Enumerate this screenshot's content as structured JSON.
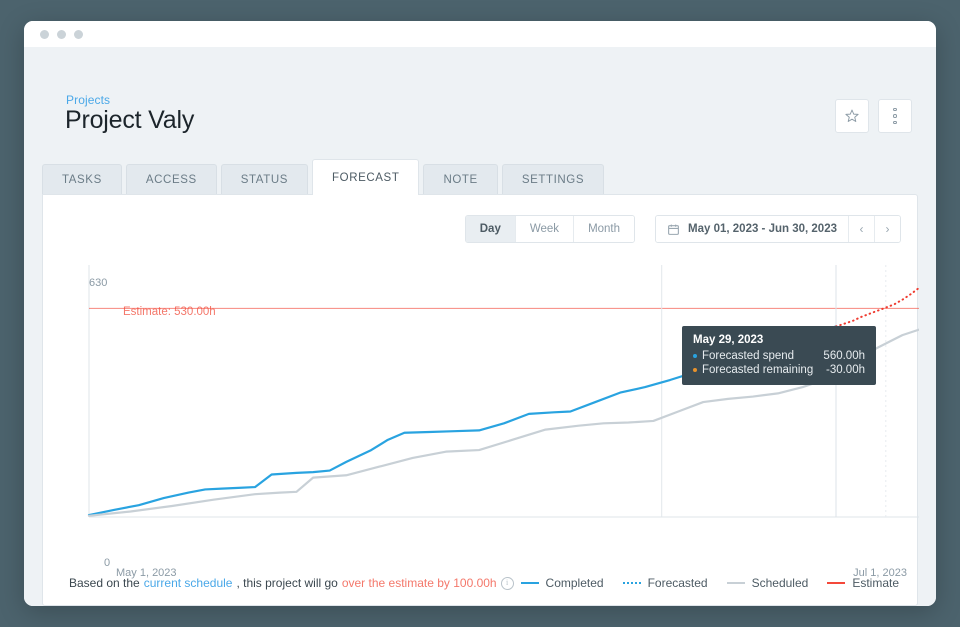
{
  "window": {
    "traffic_dots": 3
  },
  "header": {
    "breadcrumb": "Projects",
    "title": "Project Valy",
    "favorite_icon": "star-icon",
    "more_icon": "kebab-menu-icon"
  },
  "tabs": [
    {
      "label": "TASKS",
      "active": false
    },
    {
      "label": "ACCESS",
      "active": false
    },
    {
      "label": "STATUS",
      "active": false
    },
    {
      "label": "FORECAST",
      "active": true
    },
    {
      "label": "NOTE",
      "active": false
    },
    {
      "label": "SETTINGS",
      "active": false
    }
  ],
  "toolbar": {
    "granularity": [
      {
        "label": "Day",
        "active": true
      },
      {
        "label": "Week",
        "active": false
      },
      {
        "label": "Month",
        "active": false
      }
    ],
    "date_range": "May 01, 2023 - Jun 30, 2023",
    "calendar_icon": "calendar-icon",
    "prev_label": "‹",
    "next_label": "›"
  },
  "tooltip": {
    "date": "May 29, 2023",
    "rows": [
      {
        "label": "Forecasted spend",
        "value": "560.00h",
        "color": "#29a3e0"
      },
      {
        "label": "Forecasted remaining",
        "value": "-30.00h",
        "color": "#e8922c"
      }
    ]
  },
  "footer": {
    "note_prefix": "Based on the ",
    "note_link": "current schedule",
    "note_middle": ", this project will go ",
    "note_warning": "over the estimate by 100.00h",
    "info_icon": "info-icon",
    "info_glyph": "i"
  },
  "legend": [
    {
      "label": "Completed",
      "color": "#29a3e0",
      "style": "solid"
    },
    {
      "label": "Forecasted",
      "color": "#29a3e0",
      "style": "dotted"
    },
    {
      "label": "Scheduled",
      "color": "#c8d0d6",
      "style": "solid"
    },
    {
      "label": "Estimate",
      "color": "#f4483a",
      "style": "solid"
    }
  ],
  "chart_data": {
    "type": "line",
    "title": "",
    "xlabel": "",
    "ylabel": "",
    "ylim": [
      0,
      630
    ],
    "y_ticks": [
      "0",
      "630"
    ],
    "x_ticks": [
      "May 1, 2023",
      "Jul 1, 2023"
    ],
    "x_range": [
      "May 1, 2023",
      "Jul 1, 2023"
    ],
    "grid": false,
    "legend_position": "bottom-right",
    "annotations": [
      {
        "text": "Estimate: 530.00h",
        "value": 530,
        "color": "#f4786b",
        "type": "hline-label"
      }
    ],
    "reference_lines": [
      {
        "name": "Estimate",
        "value": 530,
        "color": "#f4483a",
        "orientation": "horizontal"
      },
      {
        "name": "today-marker",
        "x": "Jun 15, 2023",
        "color": "#e2e7eb",
        "orientation": "vertical"
      },
      {
        "name": "hover-marker",
        "x": "May 29, 2023",
        "color": "#dde3e8",
        "orientation": "vertical"
      },
      {
        "name": "end-marker",
        "x": "Jun 25, 2023",
        "color": "#e6ebef",
        "orientation": "vertical-dotted"
      }
    ],
    "series": [
      {
        "name": "Completed",
        "color": "#29a3e0",
        "style": "solid",
        "points": [
          [
            0,
            5
          ],
          [
            3,
            18
          ],
          [
            6,
            30
          ],
          [
            9,
            48
          ],
          [
            12,
            62
          ],
          [
            14,
            70
          ],
          [
            16,
            72
          ],
          [
            18,
            74
          ],
          [
            20,
            76
          ],
          [
            22,
            108
          ],
          [
            25,
            112
          ],
          [
            27,
            114
          ],
          [
            29,
            118
          ],
          [
            31,
            140
          ],
          [
            34,
            170
          ],
          [
            36,
            196
          ],
          [
            38,
            214
          ],
          [
            41,
            216
          ],
          [
            44,
            218
          ],
          [
            47,
            220
          ],
          [
            50,
            238
          ],
          [
            53,
            262
          ],
          [
            56,
            266
          ],
          [
            58,
            268
          ],
          [
            61,
            292
          ],
          [
            64,
            316
          ],
          [
            67,
            330
          ],
          [
            70,
            348
          ],
          [
            73,
            368
          ],
          [
            76,
            392
          ],
          [
            79,
            414
          ],
          [
            82,
            430
          ],
          [
            85,
            452
          ],
          [
            88,
            470
          ],
          [
            90,
            484
          ]
        ]
      },
      {
        "name": "Scheduled",
        "color": "#c8d0d6",
        "style": "solid",
        "points": [
          [
            0,
            3
          ],
          [
            5,
            14
          ],
          [
            10,
            28
          ],
          [
            15,
            44
          ],
          [
            20,
            58
          ],
          [
            23,
            62
          ],
          [
            25,
            64
          ],
          [
            27,
            100
          ],
          [
            31,
            106
          ],
          [
            35,
            128
          ],
          [
            39,
            150
          ],
          [
            43,
            166
          ],
          [
            47,
            170
          ],
          [
            51,
            196
          ],
          [
            55,
            222
          ],
          [
            59,
            232
          ],
          [
            62,
            238
          ],
          [
            65,
            240
          ],
          [
            68,
            244
          ],
          [
            71,
            268
          ],
          [
            74,
            292
          ],
          [
            77,
            300
          ],
          [
            80,
            306
          ],
          [
            83,
            314
          ],
          [
            86,
            330
          ],
          [
            89,
            352
          ],
          [
            92,
            390
          ],
          [
            95,
            430
          ],
          [
            98,
            462
          ],
          [
            100,
            476
          ]
        ]
      },
      {
        "name": "Forecasted",
        "color": "#ef3b30",
        "style": "dotted",
        "points": [
          [
            90,
            484
          ],
          [
            92,
            498
          ],
          [
            93,
            508
          ],
          [
            94,
            516
          ],
          [
            95,
            524
          ],
          [
            96,
            532
          ],
          [
            97,
            540
          ],
          [
            98,
            552
          ],
          [
            99,
            566
          ],
          [
            100,
            582
          ]
        ]
      }
    ]
  }
}
